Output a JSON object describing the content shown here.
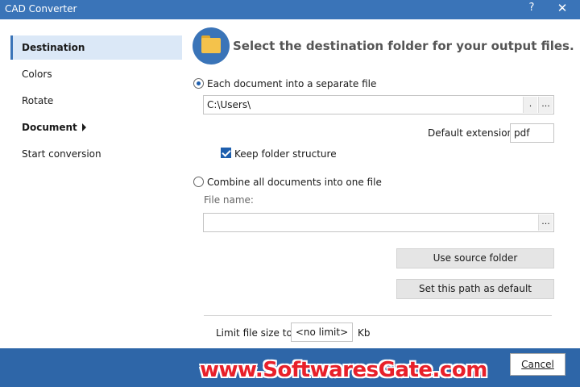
{
  "window": {
    "title": "CAD Converter",
    "help_symbol": "?",
    "close_symbol": "✕"
  },
  "sidebar": {
    "items": [
      {
        "label": "Destination",
        "active": true
      },
      {
        "label": "Colors"
      },
      {
        "label": "Rotate"
      },
      {
        "label": "Document",
        "bold": true,
        "has_submenu": true
      },
      {
        "label": "Start conversion"
      }
    ]
  },
  "main": {
    "icon": "folder-icon",
    "heading": "Select the destination folder for your output files.",
    "separate": {
      "label": "Each document into a separate file",
      "selected": true,
      "path_value": "C:\\Users\\",
      "dot_button": ".",
      "browse_button": "...",
      "ext_label": "Default extension:",
      "ext_value": "pdf",
      "keep_structure_label": "Keep folder structure",
      "keep_structure_checked": true
    },
    "combine": {
      "label": "Combine all documents into one file",
      "selected": false,
      "file_name_label": "File name:",
      "file_name_value": "",
      "browse_button": "..."
    },
    "buttons": {
      "use_source": "Use source folder",
      "set_default": "Set this path as default"
    },
    "limit": {
      "label": "Limit file size to:",
      "value": "<no limit>",
      "unit": "Kb"
    }
  },
  "footer": {
    "cancel_label": "Cancel"
  },
  "watermark": {
    "text": "www.SoftwaresGate.com"
  },
  "colors": {
    "accent": "#3a74b8",
    "bottom_bar": "#2e66a8",
    "watermark": "#e8202a"
  }
}
